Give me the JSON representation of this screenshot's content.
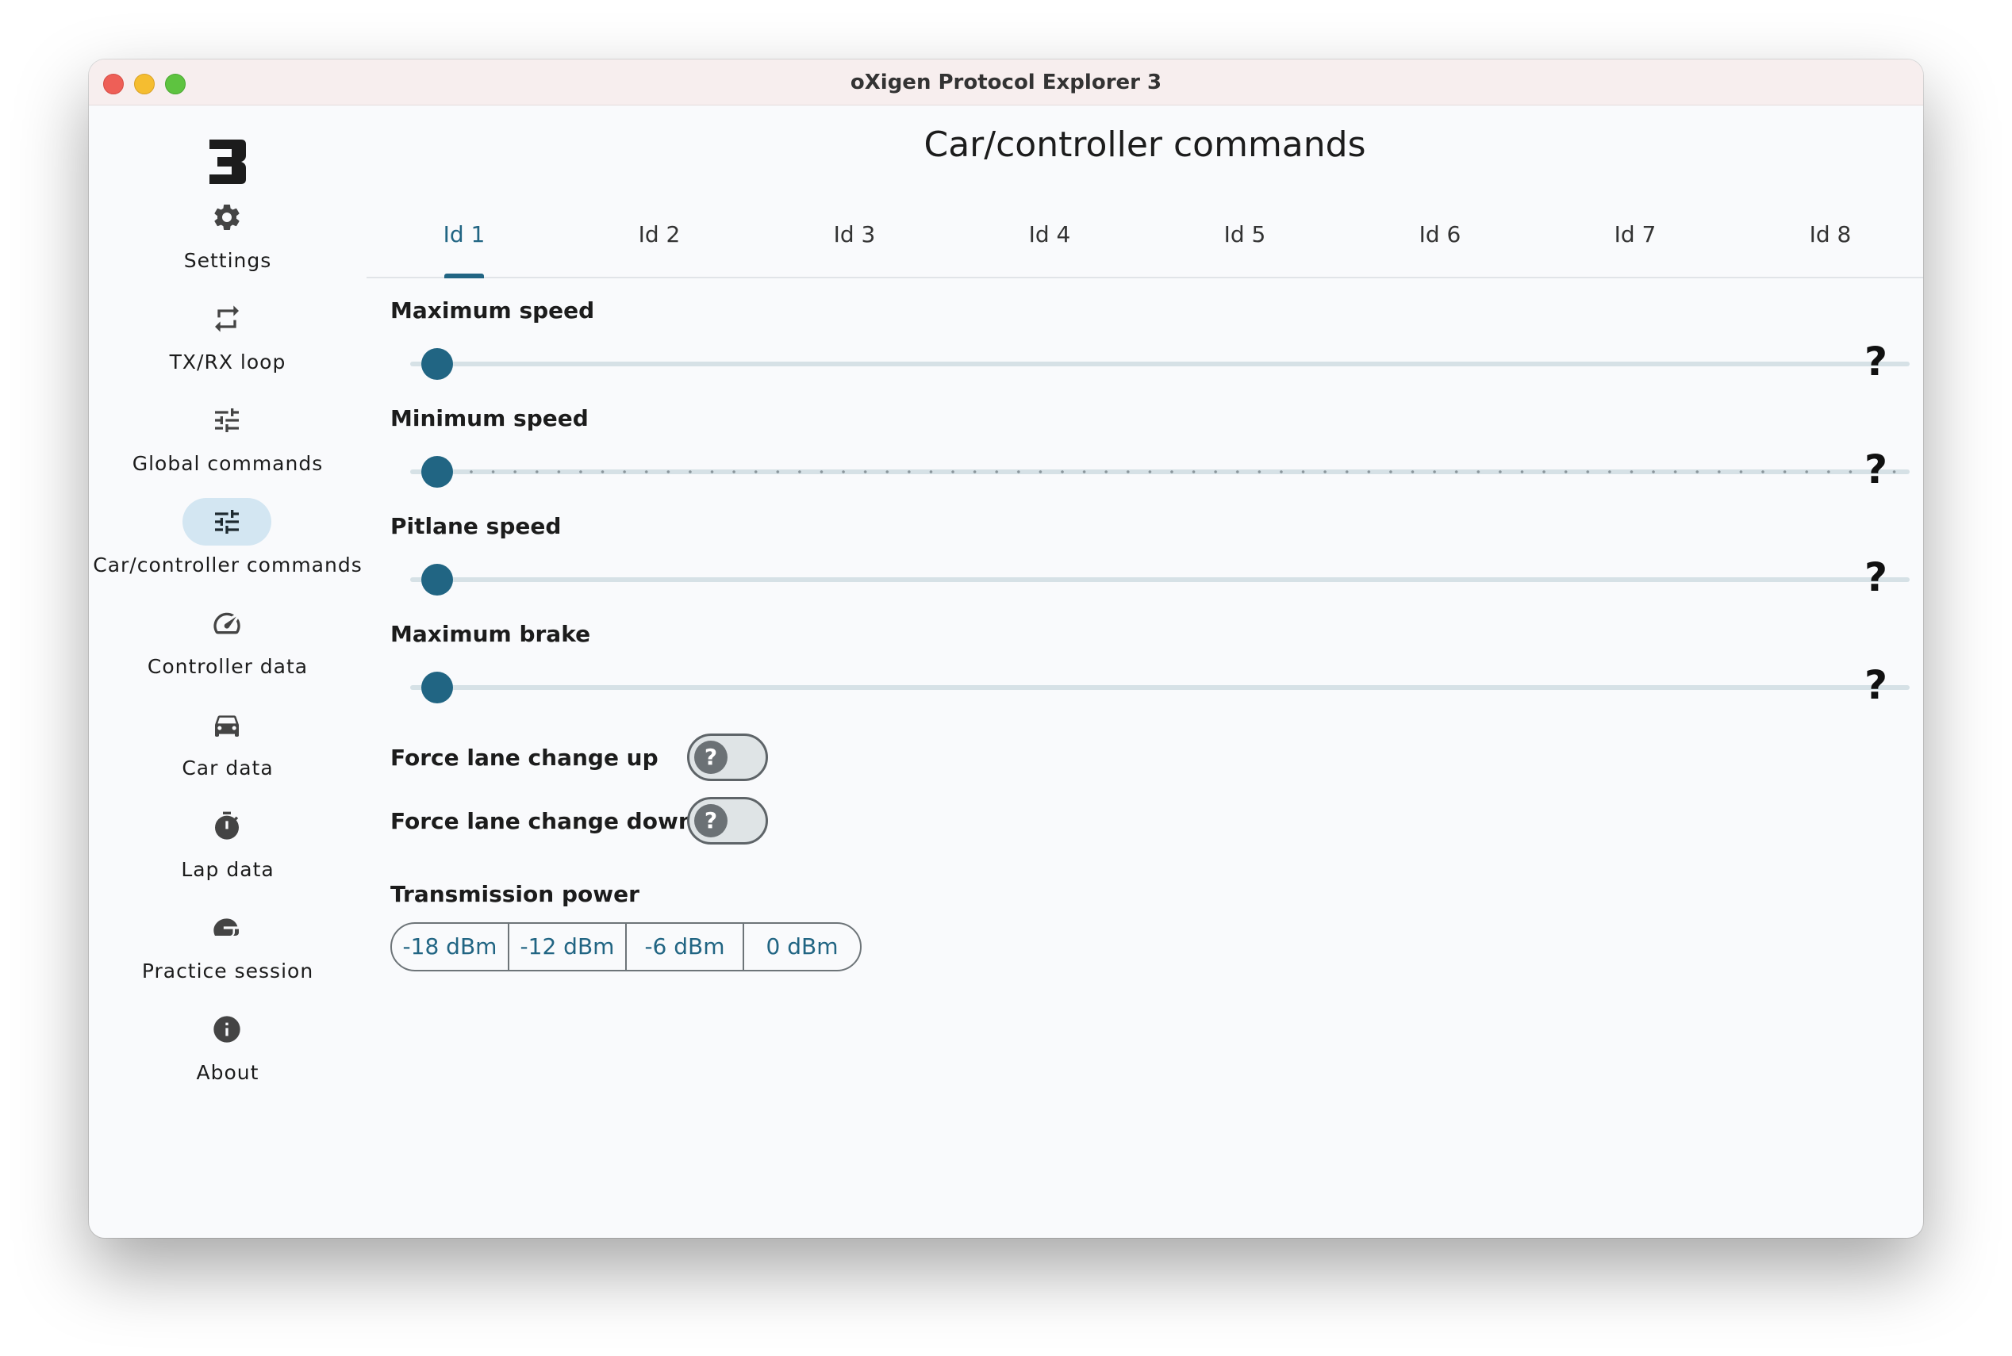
{
  "window": {
    "title": "oXigen Protocol Explorer 3"
  },
  "sidebar": {
    "logo": "3",
    "items": [
      {
        "label": "Settings",
        "icon": "gear-icon",
        "active": false
      },
      {
        "label": "TX/RX loop",
        "icon": "repeat-icon",
        "active": false
      },
      {
        "label": "Global commands",
        "icon": "tune-icon",
        "active": false
      },
      {
        "label": "Car/controller commands",
        "icon": "tune-icon",
        "active": true
      },
      {
        "label": "Controller data",
        "icon": "speedometer-icon",
        "active": false
      },
      {
        "label": "Car data",
        "icon": "car-icon",
        "active": false
      },
      {
        "label": "Lap data",
        "icon": "stopwatch-icon",
        "active": false
      },
      {
        "label": "Practice session",
        "icon": "helmet-icon",
        "active": false
      },
      {
        "label": "About",
        "icon": "info-icon",
        "active": false
      }
    ]
  },
  "main": {
    "title": "Car/controller commands",
    "tabs": [
      "Id 1",
      "Id 2",
      "Id 3",
      "Id 4",
      "Id 5",
      "Id 6",
      "Id 7",
      "Id 8"
    ],
    "active_tab": 0,
    "sliders": [
      {
        "label": "Maximum speed",
        "value": 0
      },
      {
        "label": "Minimum speed",
        "value": 0
      },
      {
        "label": "Pitlane speed",
        "value": 0
      },
      {
        "label": "Maximum brake",
        "value": 0
      }
    ],
    "help_mark": "?",
    "switches": [
      {
        "label": "Force lane change up",
        "on": false,
        "knob": "?"
      },
      {
        "label": "Force lane change down",
        "on": false,
        "knob": "?"
      }
    ],
    "transmission_power": {
      "label": "Transmission power",
      "options": [
        "-18 dBm",
        "-12 dBm",
        "-6 dBm",
        "0 dBm"
      ]
    }
  },
  "colors": {
    "accent": "#216583",
    "active_nav_bg": "#d3e6f2",
    "track": "#d6e1e6"
  }
}
